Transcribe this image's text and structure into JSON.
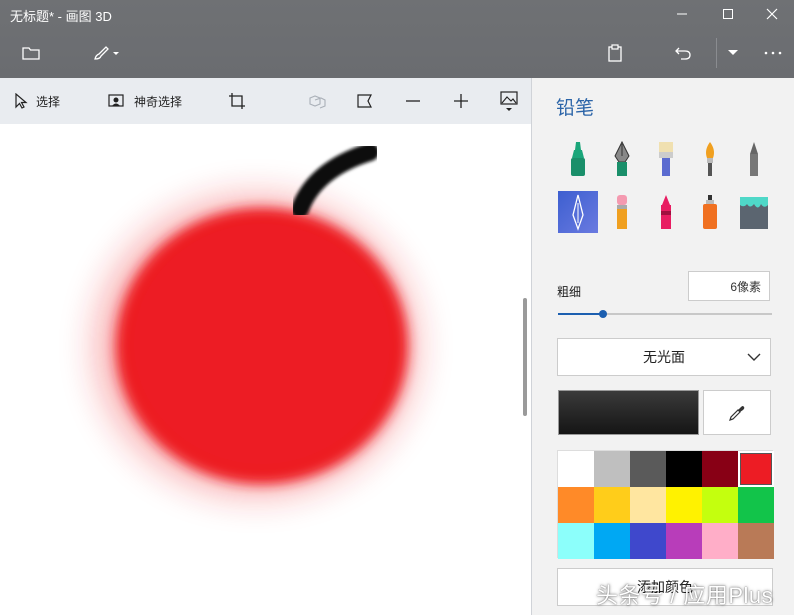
{
  "window": {
    "title": "无标题* - 画图 3D"
  },
  "subtoolbar": {
    "select_label": "选择",
    "magic_select_label": "神奇选择"
  },
  "panel": {
    "title": "铅笔",
    "tools": [
      "marker-icon",
      "calligraphy-pen-icon",
      "oil-brush-icon",
      "watercolor-icon",
      "pencil-icon",
      "pixel-pen-icon",
      "eraser-icon",
      "crayon-icon",
      "spray-can-icon",
      "fill-bucket-icon"
    ],
    "selected_tool": "pixel-pen-icon",
    "thickness_label": "粗细",
    "thickness_value": "6像素",
    "thickness_fraction": 0.21,
    "finish_label": "无光面",
    "current_color": "#202020",
    "palette": [
      "#ffffff",
      "#bfbfbf",
      "#5a5a5a",
      "#000000",
      "#880015",
      "#ed1c24",
      "#ff8a28",
      "#ffcd1a",
      "#ffe6a0",
      "#fff200",
      "#c4ff0e",
      "#12c44a",
      "#8cfffb",
      "#00a8f3",
      "#3f48cc",
      "#b83dba",
      "#ffaec8",
      "#b97a57"
    ],
    "selected_color": "#ed1c24",
    "add_color_label": "添加颜色"
  },
  "watermark": "头条号 / 应用Plus"
}
